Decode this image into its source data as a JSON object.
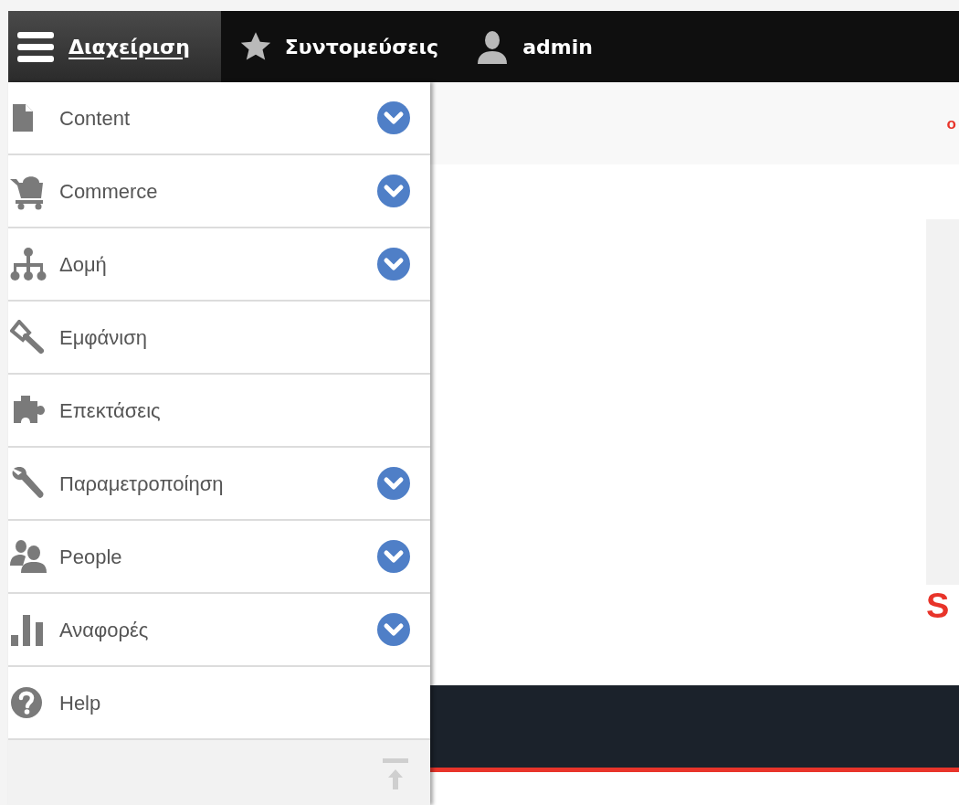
{
  "toolbar": {
    "tabs": [
      {
        "label": "Διαχείριση",
        "selected": true
      },
      {
        "label": "Συντομεύσεις",
        "selected": false
      },
      {
        "label": "admin",
        "selected": false
      }
    ]
  },
  "sidebar": {
    "items": [
      {
        "label": "Content",
        "expandable": true
      },
      {
        "label": "Commerce",
        "expandable": true
      },
      {
        "label": "Δομή",
        "expandable": true
      },
      {
        "label": "Εμφάνιση",
        "expandable": false
      },
      {
        "label": "Επεκτάσεις",
        "expandable": false
      },
      {
        "label": "Παραμετροποίηση",
        "expandable": true
      },
      {
        "label": "People",
        "expandable": true
      },
      {
        "label": "Αναφορές",
        "expandable": true
      },
      {
        "label": "Help",
        "expandable": false
      }
    ]
  },
  "page": {
    "header_text": "o",
    "heading": "S"
  }
}
